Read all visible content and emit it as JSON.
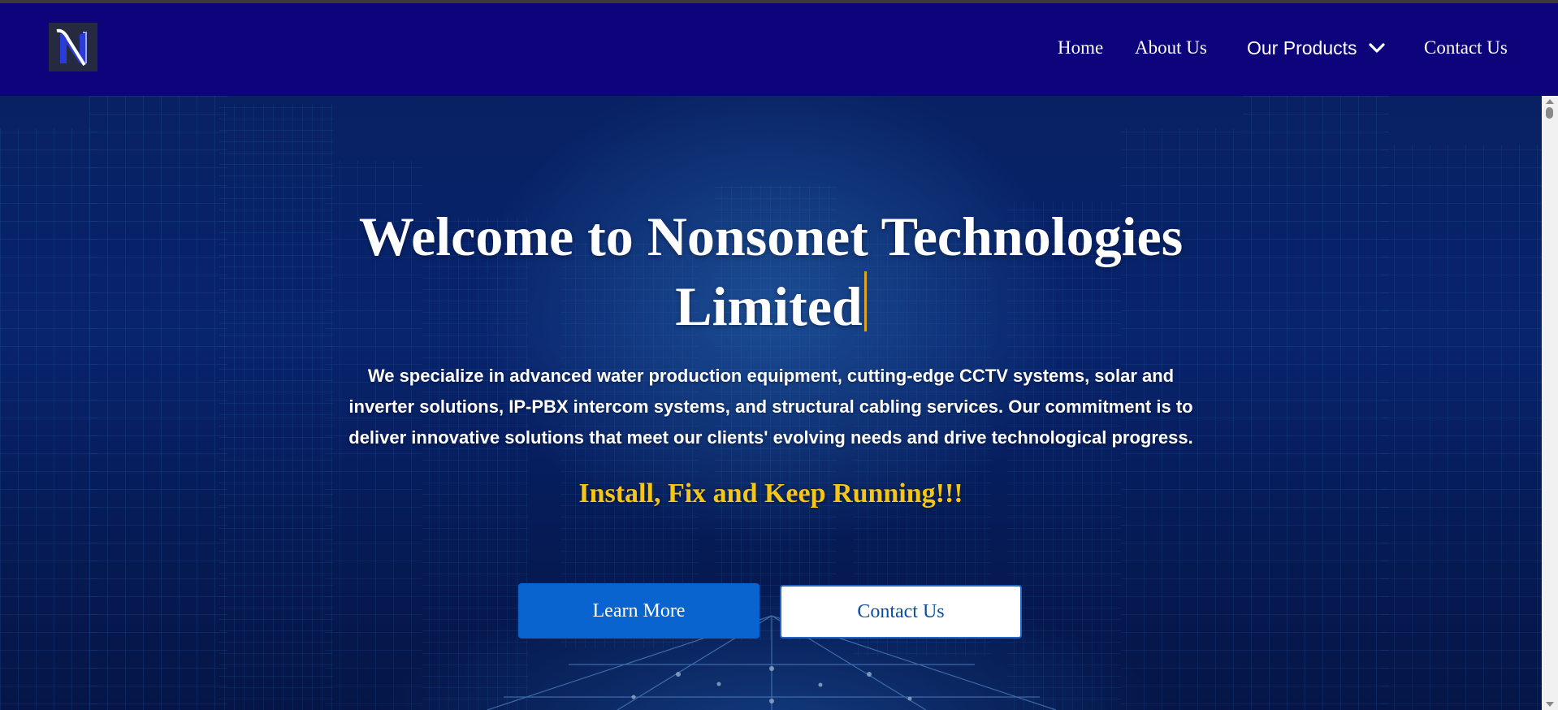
{
  "nav": {
    "logo_alt": "N",
    "items": [
      {
        "label": "Home"
      },
      {
        "label": "About Us"
      },
      {
        "label": "Our Products",
        "dropdown": true,
        "icon": "chevron-down-icon"
      },
      {
        "label": "Contact Us"
      }
    ]
  },
  "hero": {
    "title": "Welcome to Nonsonet Technologies Limited",
    "description": "We specialize in advanced water production equipment, cutting-edge CCTV systems, solar and inverter solutions, IP-PBX intercom systems, and structural cabling services. Our commitment is to deliver innovative solutions that meet our clients' evolving needs and drive technological progress.",
    "tagline": "Install, Fix and Keep Running!!!",
    "buttons": {
      "learn_more": "Learn More",
      "contact_us": "Contact Us"
    }
  },
  "colors": {
    "navbar": "#0d037a",
    "tagline": "#f5c518",
    "primary_button": "#0a64cf",
    "cursor": "#e0a21f"
  }
}
